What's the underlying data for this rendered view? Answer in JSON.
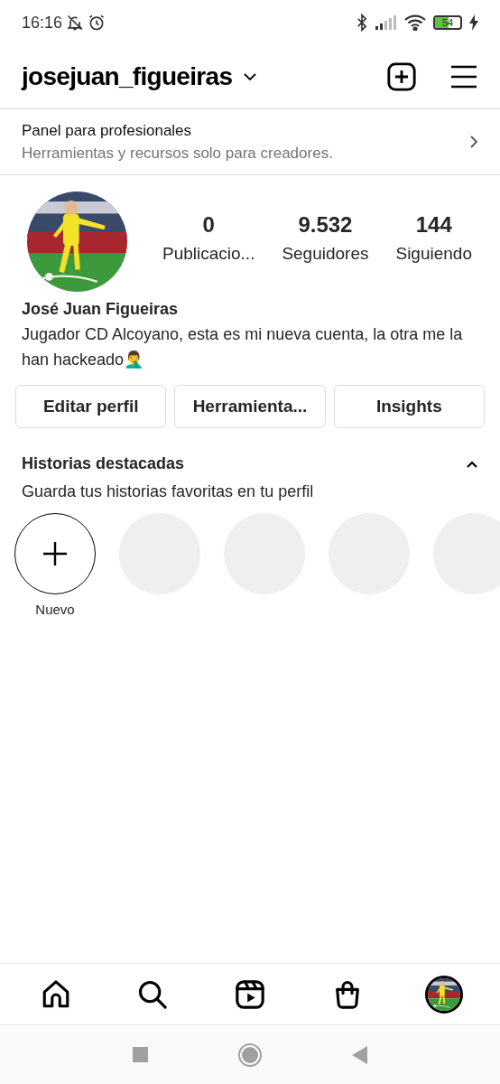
{
  "status_bar": {
    "time": "16:16",
    "battery": "54",
    "charging": true
  },
  "header": {
    "username": "josejuan_figueiras"
  },
  "pro_panel": {
    "title": "Panel para profesionales",
    "subtitle": "Herramientas y recursos solo para creadores."
  },
  "profile": {
    "stats": [
      {
        "value": "0",
        "label": "Publicacio..."
      },
      {
        "value": "9.532",
        "label": "Seguidores"
      },
      {
        "value": "144",
        "label": "Siguiendo"
      }
    ],
    "name": "José Juan Figueiras",
    "bio": "Jugador CD Alcoyano, esta es mi nueva cuenta, la otra me la han hackeado🤦‍♂️"
  },
  "buttons": [
    "Editar perfil",
    "Herramienta...",
    "Insights"
  ],
  "highlights": {
    "title": "Historias destacadas",
    "subtitle": "Guarda tus historias favoritas en tu perfil",
    "expanded": true,
    "items": [
      {
        "kind": "new",
        "label": "Nuevo"
      },
      {
        "kind": "empty"
      },
      {
        "kind": "empty"
      },
      {
        "kind": "empty"
      },
      {
        "kind": "empty"
      }
    ]
  },
  "bottom_nav": [
    {
      "kind": "home",
      "selected": false
    },
    {
      "kind": "search",
      "selected": false
    },
    {
      "kind": "reels",
      "selected": false
    },
    {
      "kind": "shop",
      "selected": false
    },
    {
      "kind": "profile",
      "selected": true
    }
  ]
}
